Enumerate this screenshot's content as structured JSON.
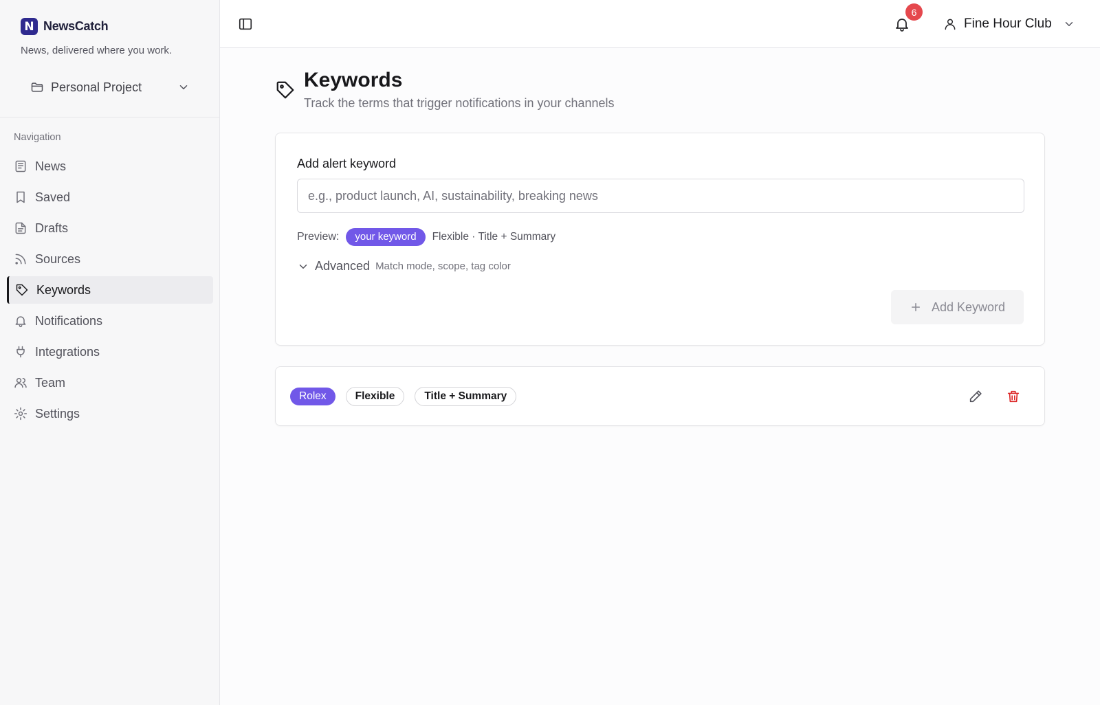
{
  "brand": {
    "logo_letter": "N",
    "name": "NewsCatch",
    "tagline": "News, delivered where you work."
  },
  "project": {
    "selected": "Personal Project"
  },
  "nav": {
    "heading": "Navigation",
    "items": [
      {
        "label": "News",
        "icon": "newspaper-icon"
      },
      {
        "label": "Saved",
        "icon": "bookmark-icon"
      },
      {
        "label": "Drafts",
        "icon": "file-text-icon"
      },
      {
        "label": "Sources",
        "icon": "rss-icon"
      },
      {
        "label": "Keywords",
        "icon": "tag-icon",
        "active": true
      },
      {
        "label": "Notifications",
        "icon": "bell-icon"
      },
      {
        "label": "Integrations",
        "icon": "plug-icon"
      },
      {
        "label": "Team",
        "icon": "users-icon"
      },
      {
        "label": "Settings",
        "icon": "gear-icon"
      }
    ]
  },
  "topbar": {
    "notification_count": "6",
    "account_name": "Fine Hour Club"
  },
  "page": {
    "title": "Keywords",
    "subtitle": "Track the terms that trigger notifications in your channels"
  },
  "add_form": {
    "label": "Add alert keyword",
    "placeholder": "e.g., product launch, AI, sustainability, breaking news",
    "value": "",
    "preview_label": "Preview:",
    "preview_keyword": "your keyword",
    "preview_meta": "Flexible · Title + Summary",
    "advanced_label": "Advanced",
    "advanced_hint": "Match mode, scope, tag color",
    "add_button": "Add Keyword"
  },
  "keywords": [
    {
      "term": "Rolex",
      "match_mode": "Flexible",
      "scope": "Title + Summary"
    }
  ],
  "colors": {
    "accent": "#7158e8",
    "danger": "#dc2626",
    "badge": "#e5484d",
    "logo": "#2f2a8f"
  }
}
